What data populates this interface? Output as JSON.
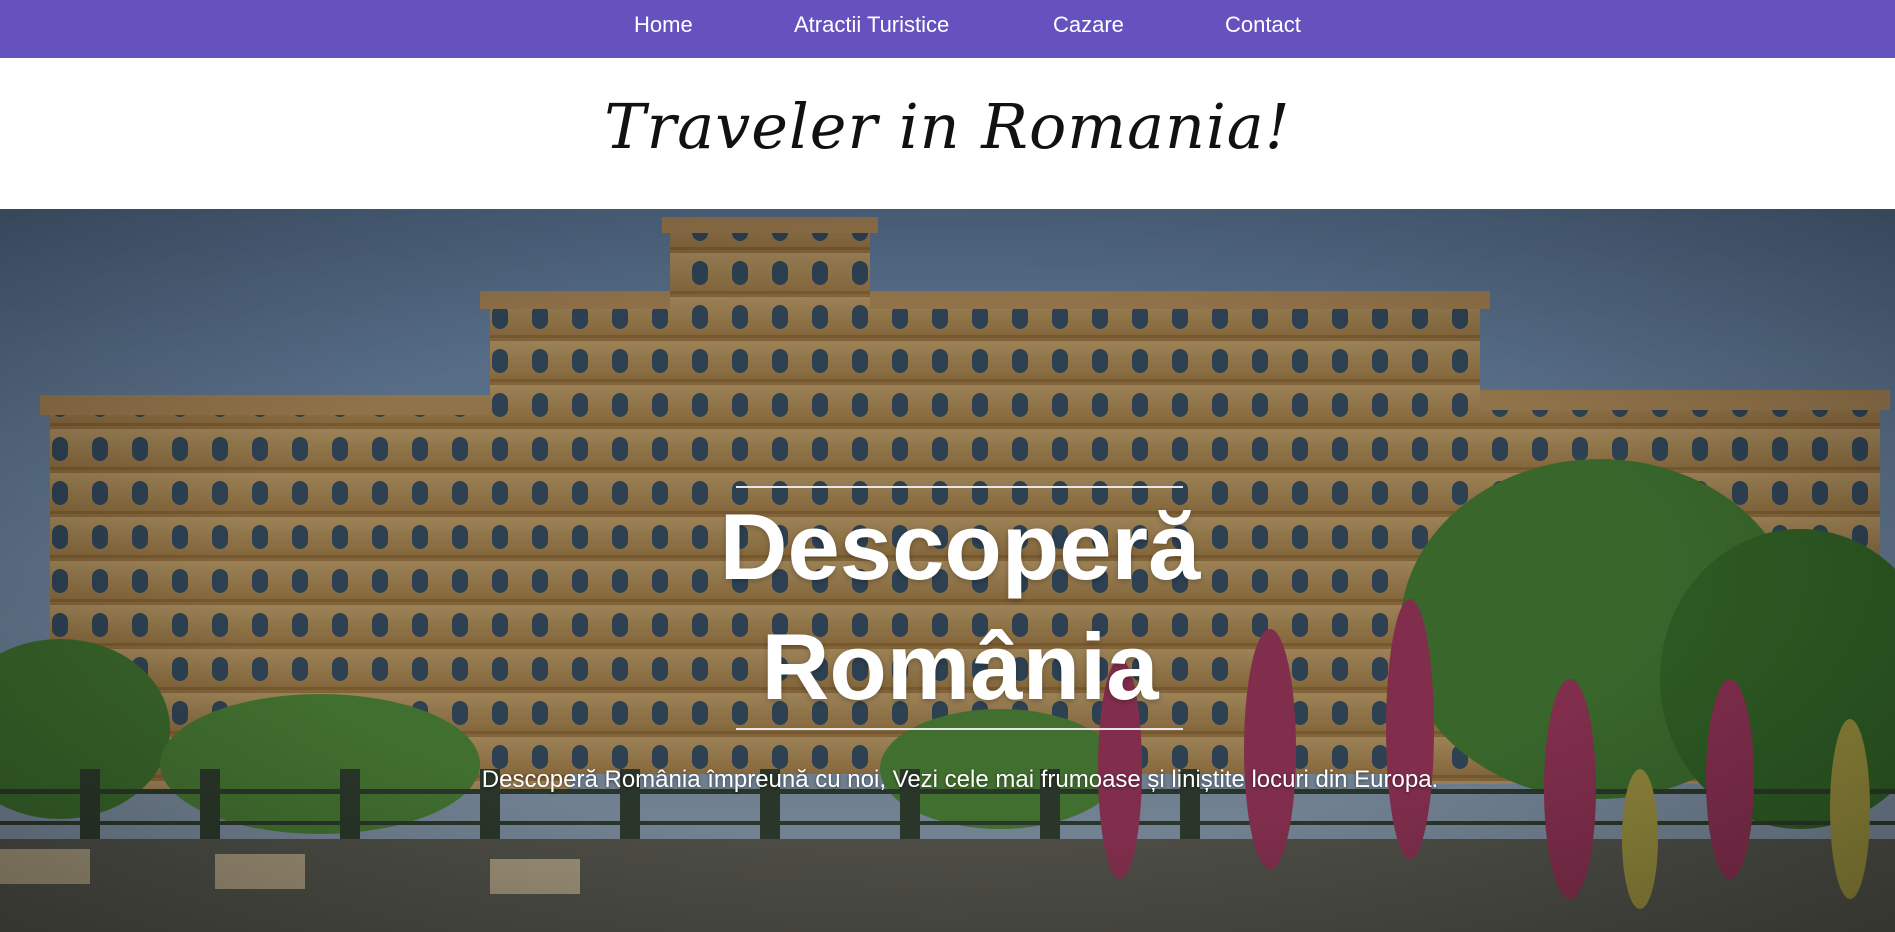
{
  "nav": {
    "items": [
      {
        "label": "Home"
      },
      {
        "label": "Atractii Turistice"
      },
      {
        "label": "Cazare"
      },
      {
        "label": "Contact"
      }
    ]
  },
  "brand": {
    "title": "Traveler in Romania!"
  },
  "hero": {
    "title_line1": "Descoperă",
    "title_line2": "România",
    "subtitle": "Descoperă România împreună cu noi, Vezi cele mai frumoase și liniștite locuri din Europa."
  },
  "colors": {
    "nav_background": "#6652bf",
    "nav_text": "#ffffff",
    "hero_text": "#ffffff"
  }
}
